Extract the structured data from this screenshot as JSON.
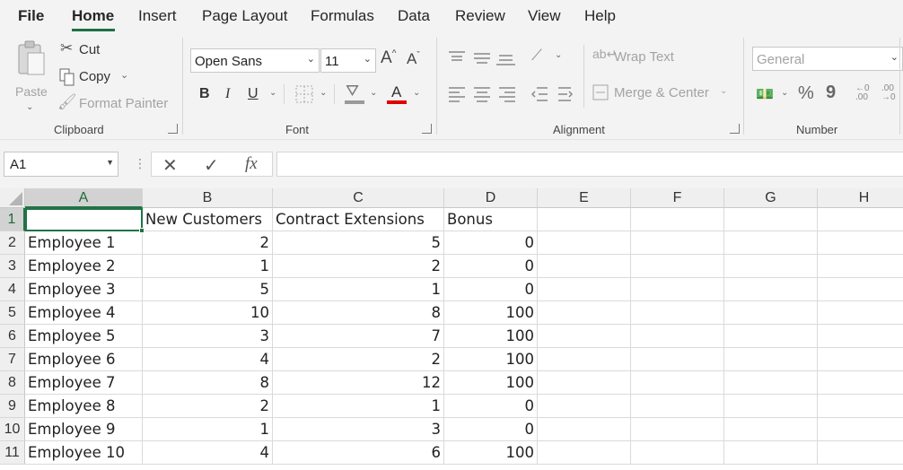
{
  "tabs": [
    "File",
    "Home",
    "Insert",
    "Page Layout",
    "Formulas",
    "Data",
    "Review",
    "View",
    "Help"
  ],
  "ribbon": {
    "clipboard": {
      "paste": "Paste",
      "cut": "Cut",
      "copy": "Copy",
      "format_painter": "Format Painter",
      "label": "Clipboard"
    },
    "font": {
      "font_name": "Open Sans",
      "font_size": "11",
      "bold": "B",
      "italic": "I",
      "underline": "U",
      "font_color_letter": "A",
      "font_color": "#e00000",
      "label": "Font"
    },
    "alignment": {
      "wrap_text": "Wrap Text",
      "merge_center": "Merge & Center",
      "label": "Alignment"
    },
    "number": {
      "format": "General",
      "percent": "%",
      "comma": "9",
      "label": "Number"
    }
  },
  "formula_bar": {
    "name_box": "A1",
    "fx": "fx",
    "formula": ""
  },
  "sheet": {
    "columns": [
      "A",
      "B",
      "C",
      "D",
      "E",
      "F",
      "G",
      "H"
    ],
    "selected_column": "A",
    "selected_row": "1",
    "header_row": [
      "",
      "New Customers",
      "Contract Extensions",
      "Bonus"
    ],
    "rows": [
      [
        "1",
        "",
        "New Customers",
        "Contract Extensions",
        "Bonus"
      ],
      [
        "2",
        "Employee 1",
        "2",
        "5",
        "0"
      ],
      [
        "3",
        "Employee 2",
        "1",
        "2",
        "0"
      ],
      [
        "4",
        "Employee 3",
        "5",
        "1",
        "0"
      ],
      [
        "5",
        "Employee 4",
        "10",
        "8",
        "100"
      ],
      [
        "6",
        "Employee 5",
        "3",
        "7",
        "100"
      ],
      [
        "7",
        "Employee 6",
        "4",
        "2",
        "100"
      ],
      [
        "8",
        "Employee 7",
        "8",
        "12",
        "100"
      ],
      [
        "9",
        "Employee 8",
        "2",
        "1",
        "0"
      ],
      [
        "10",
        "Employee 9",
        "1",
        "3",
        "0"
      ],
      [
        "11",
        "Employee 10",
        "4",
        "6",
        "100"
      ]
    ],
    "accent_color": "#217346"
  }
}
